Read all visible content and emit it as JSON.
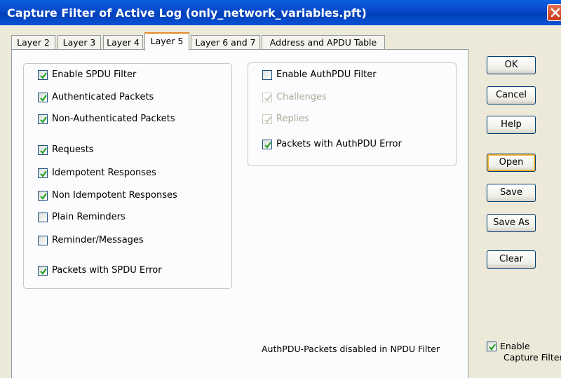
{
  "window": {
    "title": "Capture Filter of Active Log (only_network_variables.pft)"
  },
  "tabs": [
    {
      "label": "Layer 2"
    },
    {
      "label": "Layer 3"
    },
    {
      "label": "Layer 4"
    },
    {
      "label": "Layer 5",
      "active": true
    },
    {
      "label": "Layer 6 and 7"
    },
    {
      "label": "Address and APDU Table"
    }
  ],
  "spdu_group": {
    "items": [
      {
        "label": "Enable SPDU Filter",
        "checked": true
      },
      {
        "label": "Authenticated Packets",
        "checked": true
      },
      {
        "label": "Non-Authenticated Packets",
        "checked": true
      },
      {
        "label": "Requests",
        "checked": true
      },
      {
        "label": "Idempotent Responses",
        "checked": true
      },
      {
        "label": "Non Idempotent Responses",
        "checked": true
      },
      {
        "label": "Plain Reminders",
        "checked": false
      },
      {
        "label": "Reminder/Messages",
        "checked": false
      },
      {
        "label": "Packets with SPDU Error",
        "checked": true
      }
    ]
  },
  "auth_group": {
    "items": [
      {
        "label": "Enable AuthPDU Filter",
        "checked": false,
        "enabled": true
      },
      {
        "label": "Challenges",
        "checked": true,
        "enabled": false
      },
      {
        "label": "Replies",
        "checked": true,
        "enabled": false
      },
      {
        "label": "Packets with AuthPDU Error",
        "checked": true,
        "enabled": true
      }
    ]
  },
  "note": "AuthPDU-Packets disabled in NPDU Filter",
  "buttons": {
    "ok": "OK",
    "cancel": "Cancel",
    "help": "Help",
    "open": "Open",
    "save": "Save",
    "save_as": "Save As",
    "clear": "Clear"
  },
  "enable_capture": {
    "line1": "Enable",
    "line2": "Capture Filter",
    "checked": true
  },
  "colors": {
    "titlebar": "#0848c8",
    "face": "#ece9d8",
    "panel": "#fcfcfe",
    "checkmark": "#21a121",
    "tab_accent": "#e68b2c"
  }
}
